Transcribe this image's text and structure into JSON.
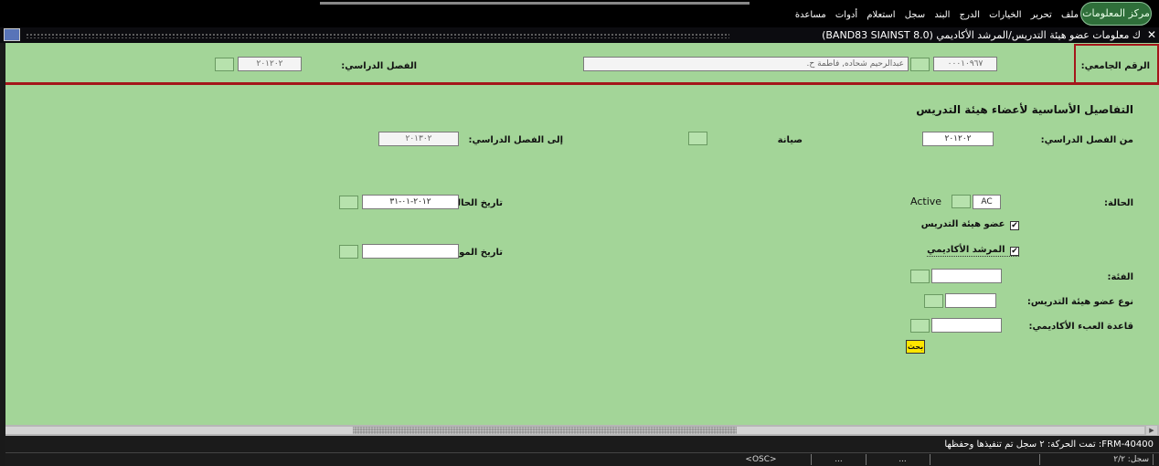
{
  "menubar": {
    "logo_text": "مركز المعلومات",
    "items": [
      "ملف",
      "تحرير",
      "الخيارات",
      "الدرج",
      "البند",
      "سجل",
      "استعلام",
      "أدوات",
      "مساعدة"
    ]
  },
  "titlebar": {
    "title": "ك معلومات عضو هيئة التدريس/المرشد الأكاديمي  (BAND83  SIAINST 8.0)",
    "close_icon": "✕"
  },
  "key_block": {
    "id_label": "الرقم الجامعي:",
    "id_value": "٠٠٠١٠٩٦٧",
    "name_value": "عبدالرحيم شحاده, فاطمة ح.",
    "term_label": "الفصل الدراسي:",
    "term_value": "٢٠١٢٠٢"
  },
  "main": {
    "section_title": "التفاصيل الأساسية لأعضاء هيئة التدريس",
    "from_term_label": "من الفصل الدراسي:",
    "from_term_value": "٢٠١٢٠٢",
    "maintenance_label": "صيانة",
    "to_term_label": "إلى الفصل الدراسي:",
    "to_term_value": "٢٠١٣٠٢",
    "status_label": "الحالة:",
    "status_code": "AC",
    "status_desc": "Active",
    "status_date_label": "تاريخ الحالة:",
    "status_date_value": "٢٠١٢-٠١-٣١",
    "faculty_member_label": "عضو هيئة التدريس",
    "faculty_member_checked": "✔",
    "advisor_label": "المرشد الأكاديمي",
    "advisor_checked": "✔",
    "appointment_date_label": "تاريخ الموعد:",
    "appointment_date_value": "",
    "category_label": "الفئة:",
    "category_value": "",
    "faculty_type_label": "نوع عضو هيئة التدريس:",
    "faculty_type_value": "",
    "academic_load_label": "قاعدة العبء الأكاديمي:",
    "academic_load_value": "",
    "search_button_label": "بحث"
  },
  "statusbar": {
    "message": "FRM-40400: تمت الحركة: ٢ سجل تم تنفيذها وحفظها",
    "record_label": "سجل: ٢/٢",
    "dots1": "...",
    "dots2": "...",
    "osc": "<OSC>"
  },
  "colors": {
    "form_bg": "#a3d598",
    "accent_red": "#a4161a",
    "search_button": "#ffe600"
  }
}
